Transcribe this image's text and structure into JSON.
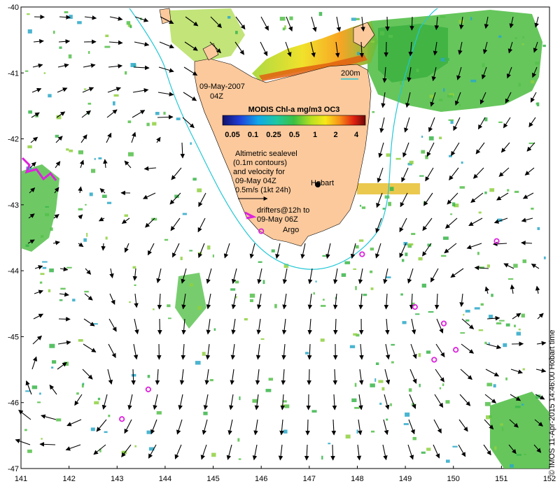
{
  "map": {
    "lon_range": [
      141,
      152
    ],
    "lat_range": [
      -47,
      -40
    ],
    "x_ticks": [
      "141",
      "142",
      "143",
      "144",
      "145",
      "146",
      "147",
      "148",
      "149",
      "150",
      "151",
      "152"
    ],
    "y_ticks": [
      "-40",
      "-41",
      "-42",
      "-43",
      "-44",
      "-45",
      "-46",
      "-47"
    ],
    "date_line1": "09-May-2007",
    "date_line2": "04Z",
    "colorbar_title": "MODIS Chl-a mg/m3 OC3",
    "colorbar_ticks": [
      "0.05",
      "0.1",
      "0.25",
      "0.5",
      "1",
      "2",
      "4"
    ],
    "contour_label": "200m",
    "altimetry_line1": "Altimetric sealevel",
    "altimetry_line2": "(0.1m contours)",
    "altimetry_line3": "and velocity for",
    "altimetry_line4": "09-May 04Z",
    "altimetry_line5": "0.5m/s (1kt 24h)",
    "city_label": "Hobart",
    "drifters_line1": "drifters@12h to",
    "drifters_line2": "09-May 06Z",
    "argo_label": "Argo",
    "credit": "© IMOS 11-Apr-2015 14:46:00 Hobart time"
  },
  "colors": {
    "land": "#fbc99c",
    "ocean": "#ffffff",
    "isobath": "#22c8d6",
    "argo": "#dd22dd",
    "drifter": "#dd22dd",
    "arrow": "#000000",
    "chl_low": "#1a1aa0",
    "chl_mid": "#3ab54a",
    "chl_high": "#8a1010"
  },
  "chart_data": {
    "type": "map",
    "argo_floats": [
      {
        "lon": 146.0,
        "lat": -43.4
      },
      {
        "lon": 148.1,
        "lat": -43.75
      },
      {
        "lon": 150.9,
        "lat": -43.55
      },
      {
        "lon": 149.2,
        "lat": -44.55
      },
      {
        "lon": 149.8,
        "lat": -44.8
      },
      {
        "lon": 150.05,
        "lat": -45.2
      },
      {
        "lon": 149.6,
        "lat": -45.35
      },
      {
        "lon": 143.65,
        "lat": -45.8
      },
      {
        "lon": 143.1,
        "lat": -46.25
      }
    ],
    "city": {
      "name": "Hobart",
      "lon": 147.33,
      "lat": -42.88
    }
  }
}
